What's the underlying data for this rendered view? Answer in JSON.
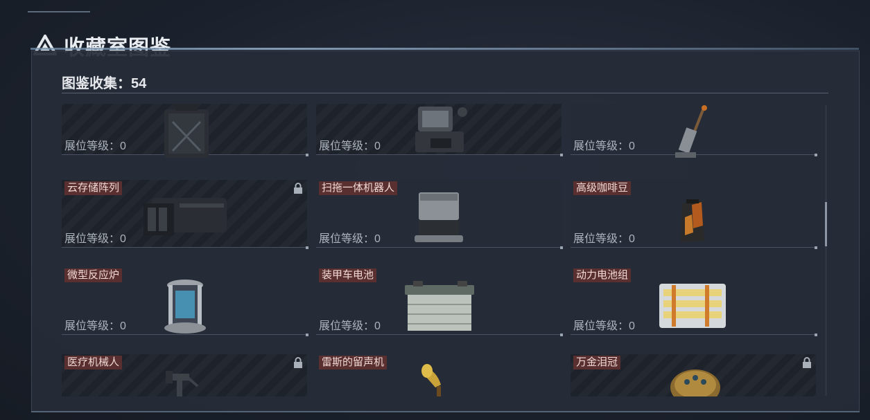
{
  "header": {
    "title": "收藏室图鉴"
  },
  "summary": {
    "count_label": "图鉴收集：54"
  },
  "colors": {
    "accent": "#9bb7d3",
    "name_tag_bg": "#5a2f2f"
  },
  "level_label": "展位等级：0",
  "items": [
    {
      "name": "",
      "level": "展位等级：0",
      "locked": true,
      "icon": "backpack-icon"
    },
    {
      "name": "",
      "level": "展位等级：0",
      "locked": true,
      "icon": "device-icon"
    },
    {
      "name": "",
      "level": "展位等级：0",
      "locked": false,
      "icon": "vacuum-icon"
    },
    {
      "name": "云存储阵列",
      "level": "展位等级：0",
      "locked": true,
      "icon": "server-icon"
    },
    {
      "name": "扫拖一体机器人",
      "level": "展位等级：0",
      "locked": false,
      "icon": "robot-icon"
    },
    {
      "name": "高级咖啡豆",
      "level": "展位等级：0",
      "locked": false,
      "icon": "coffee-bag-icon"
    },
    {
      "name": "微型反应炉",
      "level": "展位等级：0",
      "locked": false,
      "icon": "reactor-icon"
    },
    {
      "name": "装甲车电池",
      "level": "展位等级：0",
      "locked": false,
      "icon": "battery-icon"
    },
    {
      "name": "动力电池组",
      "level": "展位等级：0",
      "locked": false,
      "icon": "battery-pack-icon"
    },
    {
      "name": "医疗机械人",
      "level": "",
      "locked": true,
      "icon": "medical-robot-icon"
    },
    {
      "name": "雷斯的留声机",
      "level": "",
      "locked": false,
      "icon": "gramophone-icon"
    },
    {
      "name": "万金泪冠",
      "level": "",
      "locked": true,
      "icon": "crown-icon"
    }
  ]
}
